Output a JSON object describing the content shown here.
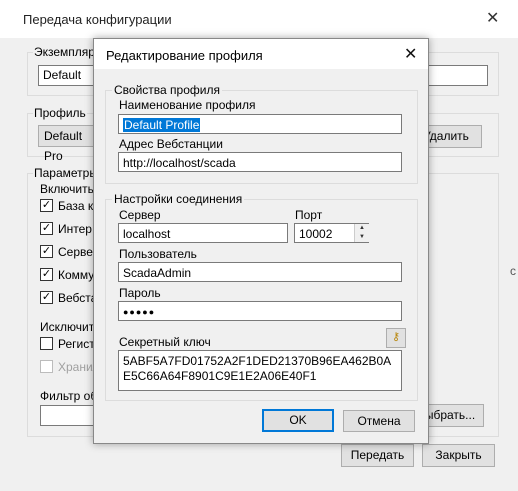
{
  "background_window": {
    "title": "Передача конфигурации",
    "instance_label": "Экземпляр",
    "instance_value": "Default",
    "profile_label": "Профиль",
    "profile_value": "Default Pro",
    "delete_button": "Удалить",
    "params_label": "Параметры",
    "include_label": "Включить:",
    "include_items": [
      {
        "label": "База к",
        "checked": true
      },
      {
        "label": "Интер",
        "checked": true
      },
      {
        "label": "Сервер",
        "checked": true
      },
      {
        "label": "Комму",
        "checked": true
      },
      {
        "label": "Вебста",
        "checked": true
      }
    ],
    "exclude_label": "Исключить",
    "exclude_items": [
      {
        "label": "Регист",
        "checked": false,
        "disabled": false
      },
      {
        "label": "Хранил",
        "checked": false,
        "disabled": true
      }
    ],
    "filter_label": "Фильтр об",
    "select_button": "ыбрать...",
    "edge_text": "с",
    "transfer_button": "Передать",
    "close_button": "Закрыть"
  },
  "dialog": {
    "title": "Редактирование профиля",
    "profile_props_group": "Свойства профиля",
    "profile_name_label": "Наименование профиля",
    "profile_name_value": "Default Profile",
    "web_address_label": "Адрес Вебстанции",
    "web_address_value": "http://localhost/scada",
    "connection_group": "Настройки соединения",
    "server_label": "Сервер",
    "server_value": "localhost",
    "port_label": "Порт",
    "port_value": "10002",
    "user_label": "Пользователь",
    "user_value": "ScadaAdmin",
    "password_label": "Пароль",
    "password_value": "●●●●●",
    "secret_key_label": "Секретный ключ",
    "secret_key_value": "5ABF5A7FD01752A2F1DED21370B96EA462B0AE5C66A64F8901C9E1E2A06E40F1",
    "ok_button": "OK",
    "cancel_button": "Отмена"
  }
}
